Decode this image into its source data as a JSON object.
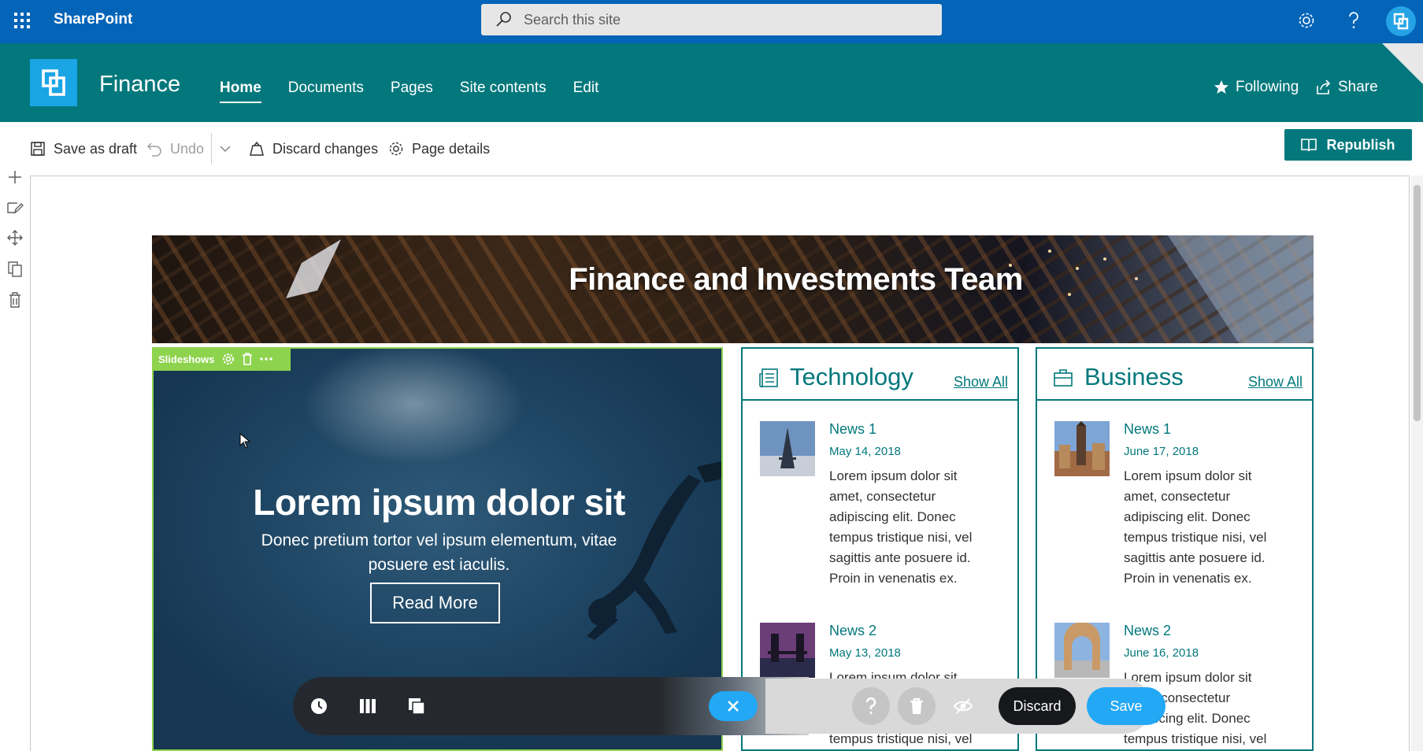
{
  "suite": {
    "brand": "SharePoint",
    "search_placeholder": "Search this site"
  },
  "site": {
    "title": "Finance",
    "nav": [
      {
        "label": "Home",
        "active": true
      },
      {
        "label": "Documents"
      },
      {
        "label": "Pages"
      },
      {
        "label": "Site contents"
      },
      {
        "label": "Edit"
      }
    ],
    "following_label": "Following",
    "share_label": "Share"
  },
  "commandbar": {
    "save_draft": "Save as draft",
    "undo": "Undo",
    "discard_changes": "Discard changes",
    "page_details": "Page details",
    "republish": "Republish"
  },
  "banner": {
    "title": "Finance and Investments Team"
  },
  "slideshow": {
    "tag": "Slideshows",
    "heading": "Lorem ipsum dolor sit",
    "subtext": "Donec pretium tortor vel ipsum elementum, vitae posuere est iaculis.",
    "button": "Read More"
  },
  "technology": {
    "title": "Technology",
    "show_all": "Show All",
    "items": [
      {
        "title": "News 1",
        "date": "May 14, 2018",
        "body": "Lorem ipsum dolor sit amet, consectetur adipiscing elit. Donec tempus tristique nisi, vel sagittis ante posuere id. Proin in venenatis ex."
      },
      {
        "title": "News 2",
        "date": "May 13, 2018",
        "body": "Lorem ipsum dolor sit amet, consectetur adipiscing elit. Donec tempus tristique nisi, vel"
      }
    ]
  },
  "business": {
    "title": "Business",
    "show_all": "Show All",
    "items": [
      {
        "title": "News 1",
        "date": "June 17, 2018",
        "body": "Lorem ipsum dolor sit amet, consectetur adipiscing elit. Donec tempus tristique nisi, vel sagittis ante posuere id. Proin in venenatis ex."
      },
      {
        "title": "News 2",
        "date": "June 16, 2018",
        "body": "Lorem ipsum dolor sit amet, consectetur adipiscing elit. Donec tempus tristique nisi, vel"
      }
    ]
  },
  "floatbar": {
    "discard": "Discard",
    "save": "Save"
  },
  "colors": {
    "suite_blue": "#0364b8",
    "site_teal": "#03787c",
    "slideshow_green": "#8ed34e",
    "save_blue": "#22a8f5"
  }
}
